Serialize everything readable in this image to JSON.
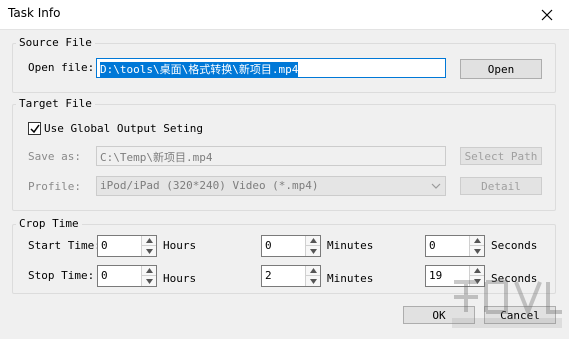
{
  "window": {
    "title": "Task Info"
  },
  "source": {
    "group_label": "Source File",
    "open_file_label": "Open file:",
    "open_file_value": "D:\\tools\\桌面\\格式转换\\新项目.mp4",
    "open_button": "Open"
  },
  "target": {
    "group_label": "Target File",
    "use_global_label": "Use Global Output Seting",
    "use_global_checked": true,
    "save_as_label": "Save as:",
    "save_as_value": "C:\\Temp\\新项目.mp4",
    "select_path_button": "Select Path",
    "profile_label": "Profile:",
    "profile_value": "iPod/iPad (320*240) Video (*.mp4)",
    "detail_button": "Detail"
  },
  "crop": {
    "group_label": "Crop Time",
    "start_label": "Start Time:",
    "stop_label": "Stop Time:",
    "hours_label": "Hours",
    "minutes_label": "Minutes",
    "seconds_label": "Seconds",
    "start": {
      "hours": "0",
      "minutes": "0",
      "seconds": "0"
    },
    "stop": {
      "hours": "0",
      "minutes": "2",
      "seconds": "19"
    }
  },
  "footer": {
    "ok_button": "OK",
    "cancel_button": "Cancel"
  }
}
